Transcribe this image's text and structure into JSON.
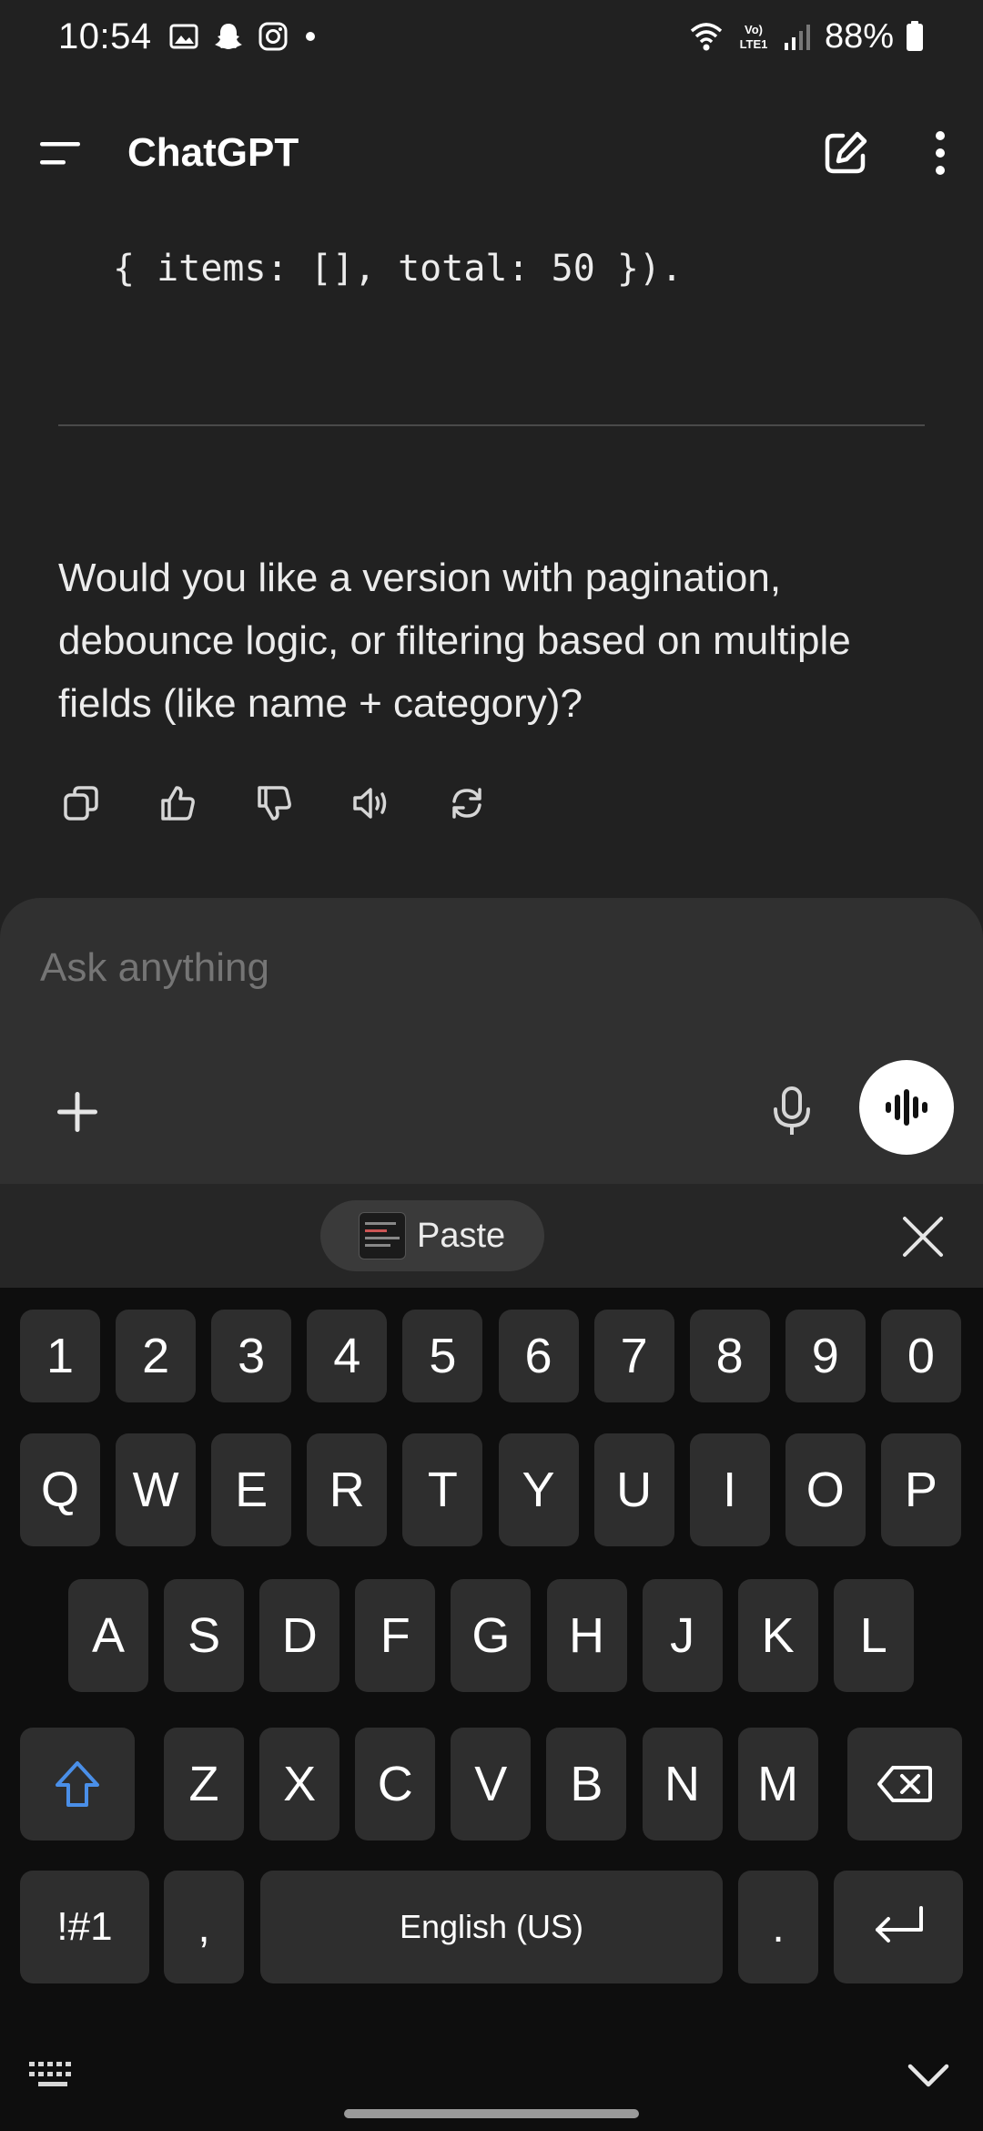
{
  "status_bar": {
    "time": "10:54",
    "battery": "88%",
    "network": "Vo) LTE1"
  },
  "header": {
    "title": "ChatGPT"
  },
  "chat": {
    "code_tail": "{ items: [], total: 50 }).",
    "assistant_message": "Would you like a version with pagination, debounce logic, or filtering based on multiple fields (like name + category)?",
    "actions": [
      "copy-icon",
      "thumbs-up-icon",
      "thumbs-down-icon",
      "read-aloud-icon",
      "regenerate-icon"
    ]
  },
  "composer": {
    "placeholder": "Ask anything"
  },
  "clipboard": {
    "paste_label": "Paste"
  },
  "keyboard": {
    "numbers": [
      "1",
      "2",
      "3",
      "4",
      "5",
      "6",
      "7",
      "8",
      "9",
      "0"
    ],
    "row1": [
      "Q",
      "W",
      "E",
      "R",
      "T",
      "Y",
      "U",
      "I",
      "O",
      "P"
    ],
    "row2": [
      "A",
      "S",
      "D",
      "F",
      "G",
      "H",
      "J",
      "K",
      "L"
    ],
    "row3": [
      "Z",
      "X",
      "C",
      "V",
      "B",
      "N",
      "M"
    ],
    "symbols_label": "!#1",
    "comma": ",",
    "space_label": "English (US)",
    "period": "."
  },
  "colors": {
    "background": "#212121",
    "composer": "#303030",
    "keyboard": "#0e0e0e",
    "key": "#2e2e2e",
    "shift_accent": "#4a8fe8"
  }
}
